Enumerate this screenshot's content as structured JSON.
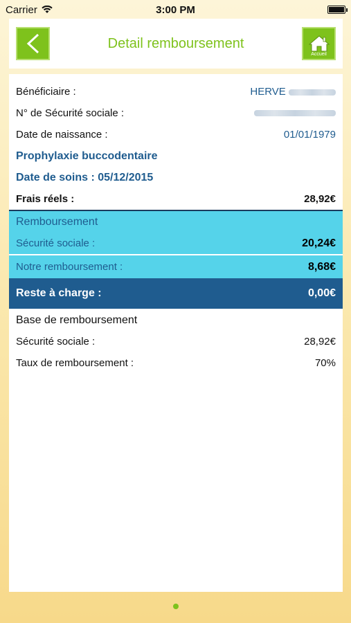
{
  "status_bar": {
    "carrier": "Carrier",
    "time": "3:00 PM"
  },
  "header": {
    "title": "Detail remboursement",
    "home_label": "Accueil"
  },
  "details": {
    "beneficiaire_label": "Bénéficiaire :",
    "beneficiaire_value": "HERVE",
    "secu_number_label": "N° de Sécurité sociale :",
    "birth_label": "Date de naissance :",
    "birth_value": "01/01/1979",
    "act_name": "Prophylaxie buccodentaire",
    "care_date": "Date de soins : 05/12/2015",
    "frais_label": "Frais réels :",
    "frais_value": "28,92€"
  },
  "reimbursement": {
    "title": "Remboursement",
    "secu_label": "Sécurité sociale :",
    "secu_value": "20,24€",
    "ours_label": "Notre remboursement :",
    "ours_value": "8,68€"
  },
  "reste": {
    "label": "Reste à charge :",
    "value": "0,00€"
  },
  "base": {
    "title": "Base de remboursement",
    "secu_label": "Sécurité sociale :",
    "secu_value": "28,92€",
    "rate_label": "Taux de remboursement :",
    "rate_value": "70%"
  },
  "colors": {
    "accent_green": "#7ec21c",
    "cyan": "#55d3ea",
    "dark_blue": "#1f5c8f"
  }
}
